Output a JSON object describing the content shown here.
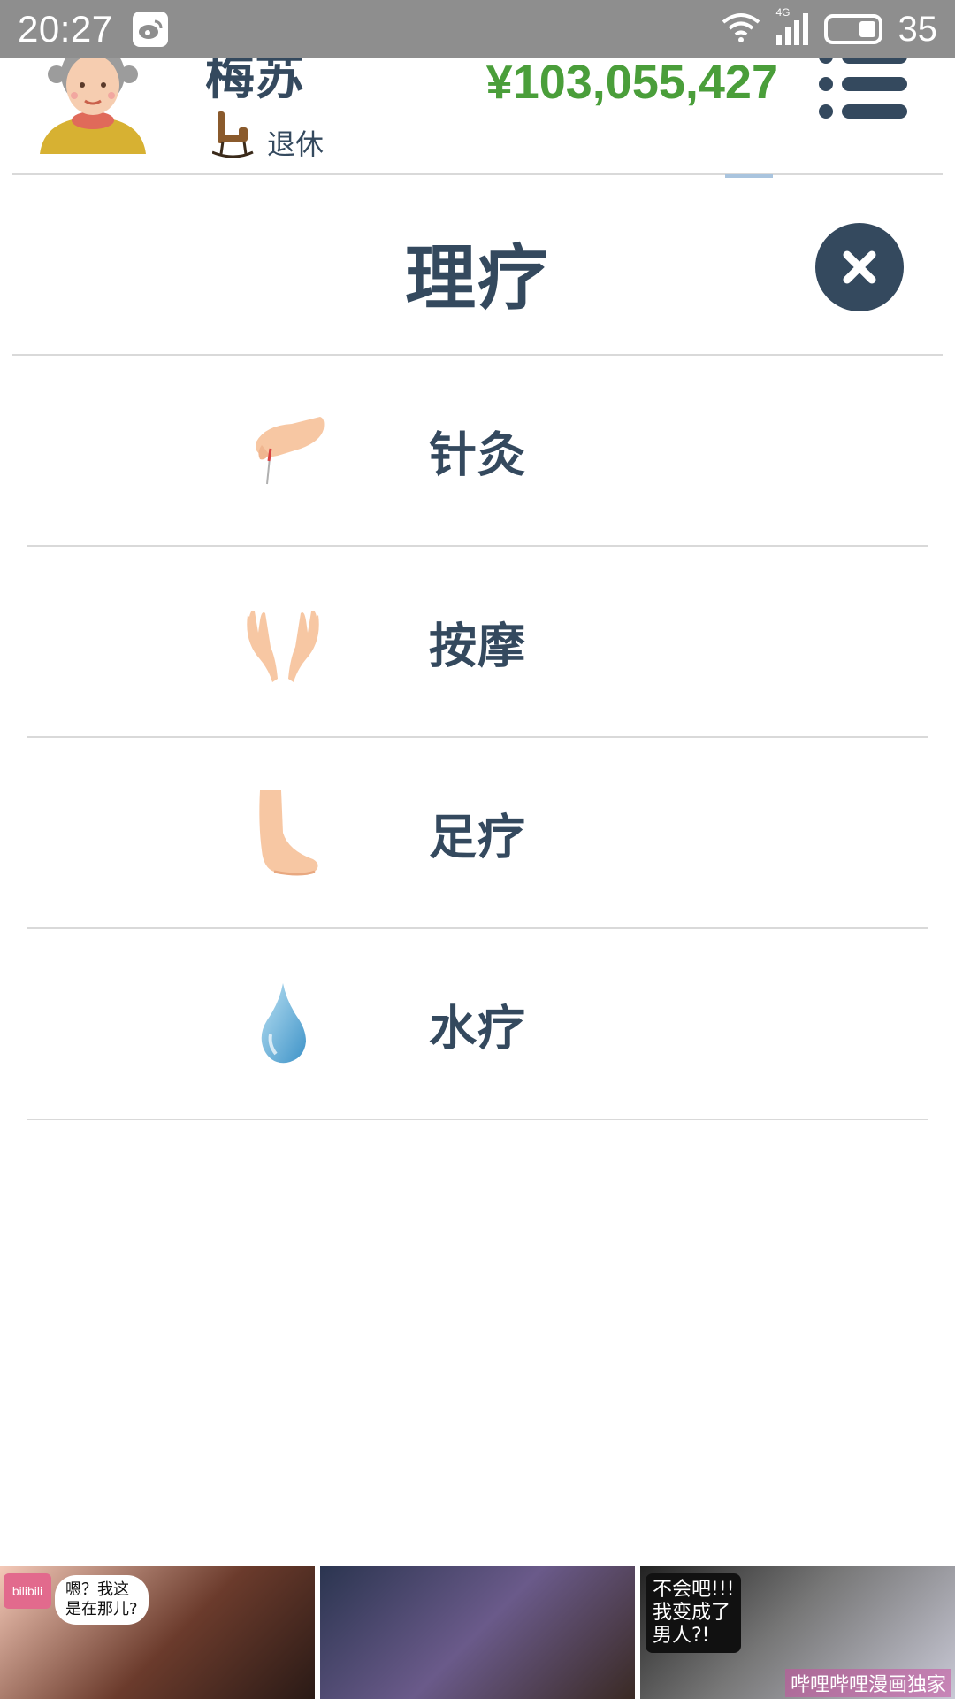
{
  "status_bar": {
    "time": "20:27",
    "network": "4G",
    "battery": "35"
  },
  "header": {
    "user_name": "梅苏",
    "status_label": "退休",
    "money": "¥103,055,427",
    "money_color": "#4a9e3a",
    "text_color": "#34495e"
  },
  "panel": {
    "title": "理疗"
  },
  "options": [
    {
      "label": "针灸",
      "icon": "acupuncture-hand-icon"
    },
    {
      "label": "按摩",
      "icon": "massage-hands-icon"
    },
    {
      "label": "足疗",
      "icon": "foot-icon"
    },
    {
      "label": "水疗",
      "icon": "water-drop-icon"
    }
  ],
  "ad": {
    "logo": "bilibili",
    "bubble1": "嗯？我这\n是在那儿?",
    "bubble3": "不会吧!!!\n我变成了\n男人?!",
    "caption": "哔哩哔哩漫画独家"
  }
}
